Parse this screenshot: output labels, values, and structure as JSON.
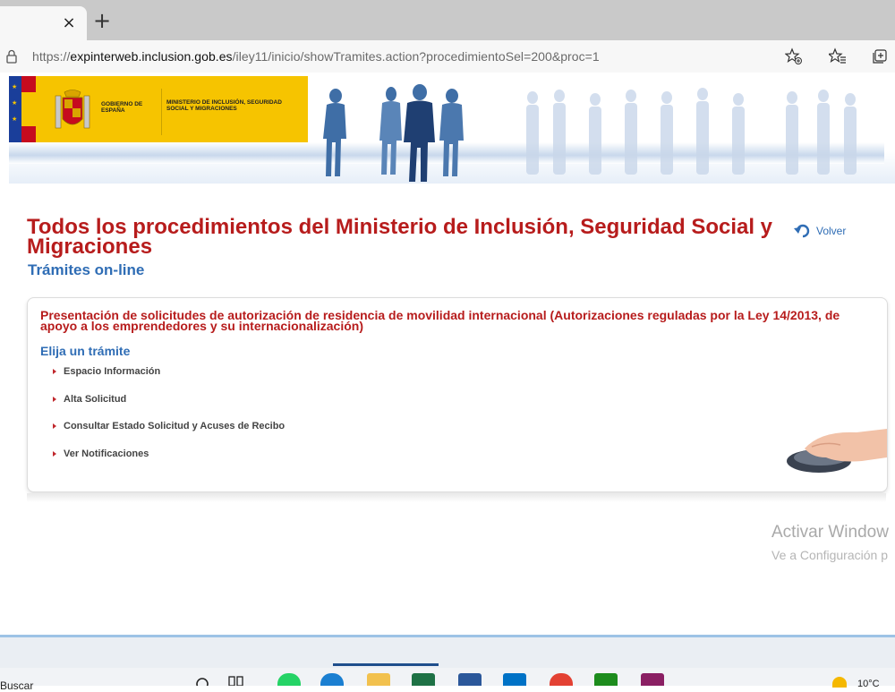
{
  "browser": {
    "tab_close_icon": "close-icon",
    "new_tab_icon": "plus-icon",
    "tab_close_glyph": "×",
    "new_tab_glyph": "+",
    "url_prefix": "https://",
    "url_host": "expinterweb.inclusion.gob.es",
    "url_path": "/iley11/inicio/showTramites.action?procedimientoSel=200&proc=1",
    "toolbar_icons": [
      "favorite-add-icon",
      "favorites-icon",
      "collections-icon"
    ]
  },
  "header": {
    "gov_label": "GOBIERNO DE ESPAÑA",
    "ministry_label": "MINISTERIO DE INCLUSIÓN, SEGURIDAD SOCIAL Y MIGRACIONES",
    "brand_yellow": "#f6c400"
  },
  "main": {
    "title": "Todos los procedimientos del Ministerio de Inclusión, Seguridad Social y Migraciones",
    "subtitle": "Trámites on-line",
    "back_label": "Volver",
    "procedure_title": "Presentación de solicitudes de autorización de residencia de movilidad internacional (Autorizaciones reguladas por la Ley 14/2013, de apoyo a los emprendedores y su internacionalización)",
    "choose_label": "Elija un trámite",
    "options": [
      {
        "label": "Espacio Información"
      },
      {
        "label": "Alta Solicitud"
      },
      {
        "label": "Consultar Estado Solicitud y Acuses de Recibo"
      },
      {
        "label": "Ver Notificaciones"
      }
    ],
    "accent_red": "#b71c1c",
    "accent_blue": "#2f6db5"
  },
  "watermark": {
    "line1": "Activar Window",
    "line2": "Ve a Configuración p"
  },
  "taskbar": {
    "search_text": "Buscar",
    "temperature": "10°C"
  }
}
